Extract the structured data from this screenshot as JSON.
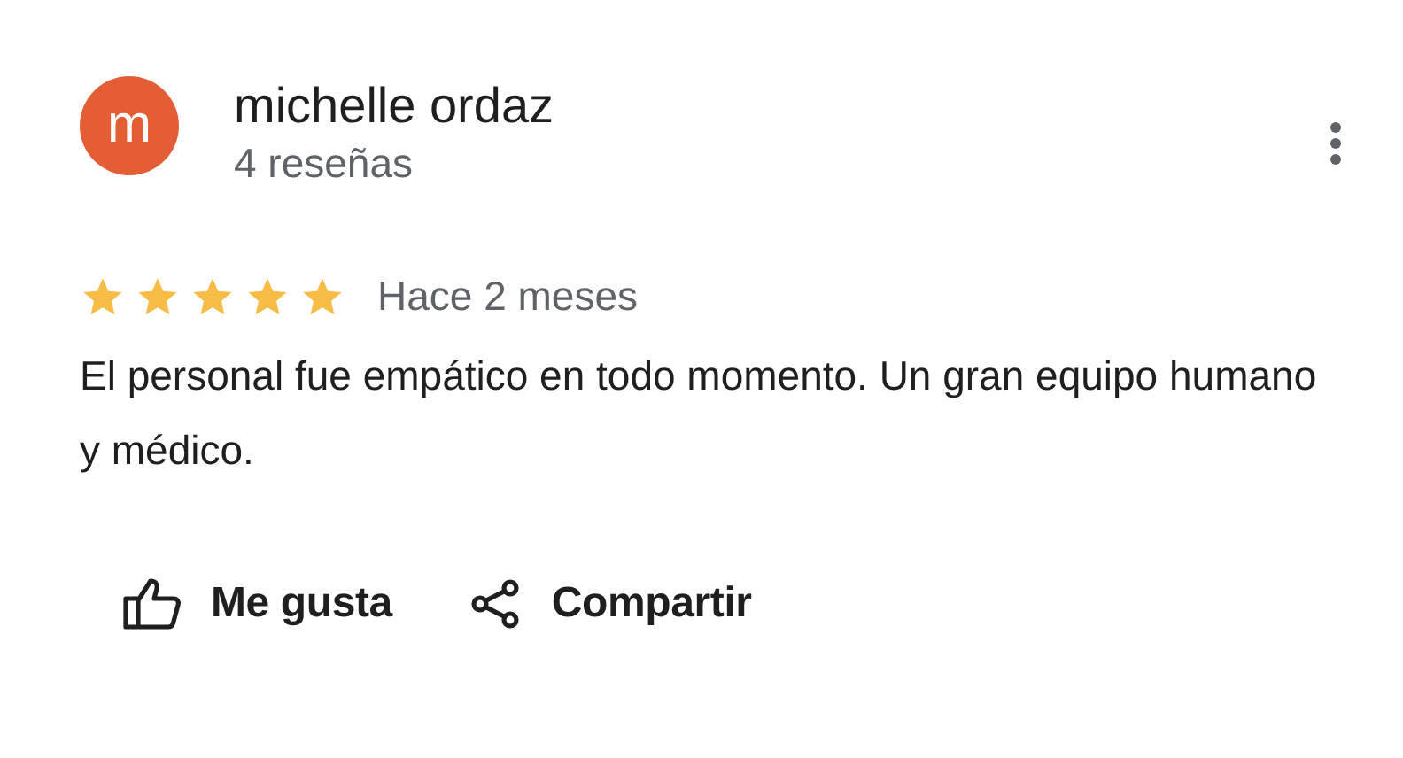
{
  "review": {
    "avatar_letter": "m",
    "author": "michelle ordaz",
    "review_count": "4 reseñas",
    "stars": 5,
    "date": "Hace 2 meses",
    "text": "El personal fue empático en todo momento. Un gran equipo humano y médico."
  },
  "actions": [
    {
      "kind": "like",
      "label": "Me gusta"
    },
    {
      "kind": "share",
      "label": "Compartir"
    }
  ]
}
